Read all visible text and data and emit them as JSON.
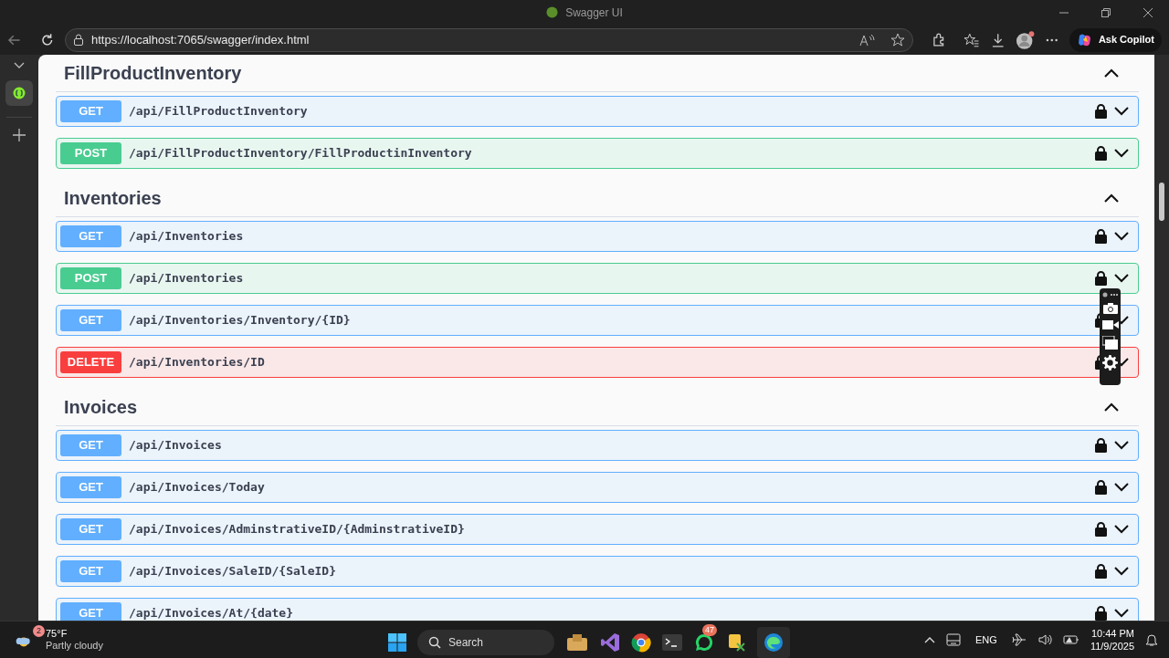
{
  "window": {
    "title": "Swagger UI"
  },
  "address_bar": {
    "url": "https://localhost:7065/swagger/index.html"
  },
  "copilot_button": {
    "label": "Ask Copilot"
  },
  "sections": [
    {
      "name": "FillProductInventory",
      "expanded": true,
      "operations": [
        {
          "kind": "get",
          "method": "GET",
          "path": "/api/FillProductInventory"
        },
        {
          "kind": "post",
          "method": "POST",
          "path": "/api/FillProductInventory/FillProductinInventory"
        }
      ]
    },
    {
      "name": "Inventories",
      "expanded": true,
      "operations": [
        {
          "kind": "get",
          "method": "GET",
          "path": "/api/Inventories"
        },
        {
          "kind": "post",
          "method": "POST",
          "path": "/api/Inventories"
        },
        {
          "kind": "get",
          "method": "GET",
          "path": "/api/Inventories/Inventory/{ID}"
        },
        {
          "kind": "delete",
          "method": "DELETE",
          "path": "/api/Inventories/ID"
        }
      ]
    },
    {
      "name": "Invoices",
      "expanded": true,
      "operations": [
        {
          "kind": "get",
          "method": "GET",
          "path": "/api/Invoices"
        },
        {
          "kind": "get",
          "method": "GET",
          "path": "/api/Invoices/Today"
        },
        {
          "kind": "get",
          "method": "GET",
          "path": "/api/Invoices/AdminstrativeID/{AdminstrativeID}"
        },
        {
          "kind": "get",
          "method": "GET",
          "path": "/api/Invoices/SaleID/{SaleID}"
        },
        {
          "kind": "get",
          "method": "GET",
          "path": "/api/Invoices/At/{date}"
        }
      ]
    }
  ],
  "taskbar": {
    "weather": {
      "badge": "2",
      "temperature": "75°F",
      "condition": "Partly cloudy"
    },
    "search": {
      "placeholder": "Search"
    },
    "whatsapp_badge": "47",
    "language": "ENG",
    "time": "10:44 PM",
    "date": "11/9/2025"
  }
}
